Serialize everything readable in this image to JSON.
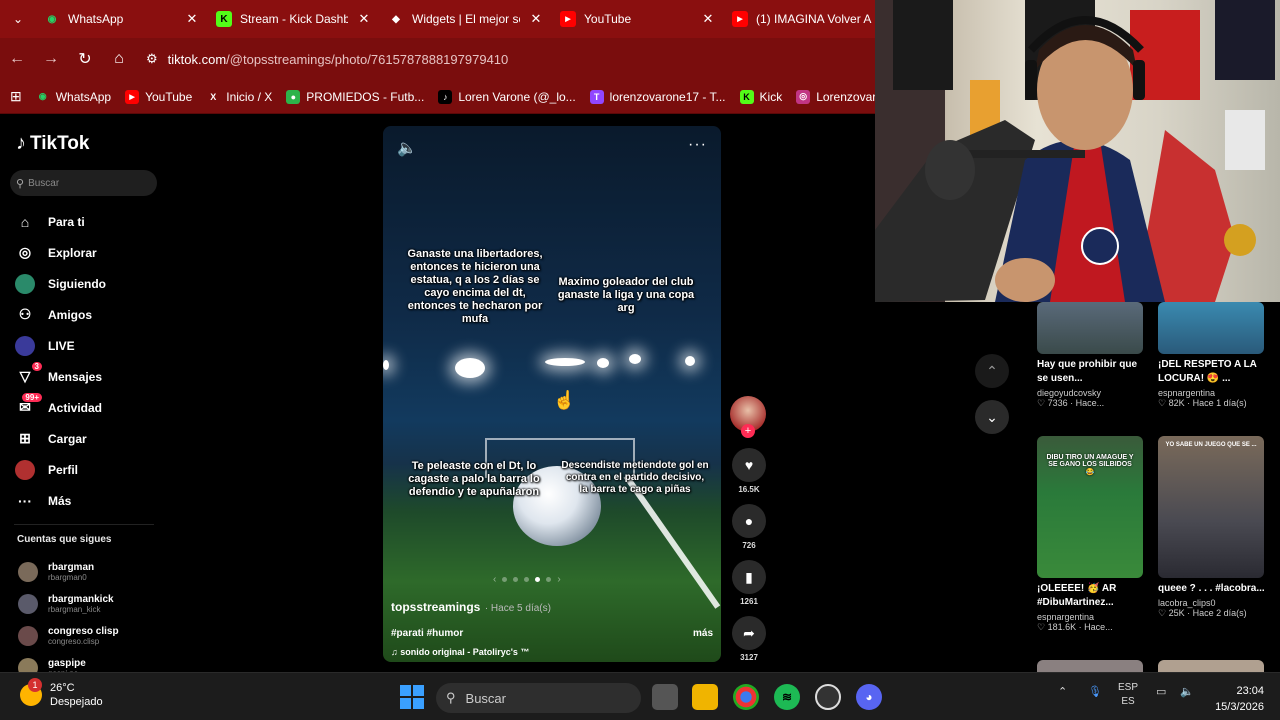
{
  "browser": {
    "tabs": [
      {
        "label": "WhatsApp",
        "color": "#25d366",
        "glyph": "W"
      },
      {
        "label": "Stream - Kick Dashbo",
        "color": "#53fc18",
        "glyph": "K"
      },
      {
        "label": "Widgets | El mejor so",
        "color": "#ffffff",
        "glyph": "◆"
      },
      {
        "label": "YouTube",
        "color": "#ff0000",
        "glyph": "▶"
      },
      {
        "label": "(1) IMAGINA Volver A",
        "color": "#ff0000",
        "glyph": "▶"
      }
    ],
    "url_domain": "tiktok.com",
    "url_path": "/@topsstreamings/photo/7615787888197979410",
    "bookmarks": [
      {
        "label": "WhatsApp",
        "color": "#25d366",
        "glyph": "W"
      },
      {
        "label": "YouTube",
        "color": "#ff0000",
        "glyph": "▶"
      },
      {
        "label": "Inicio / X",
        "color": "#000000",
        "glyph": "X"
      },
      {
        "label": "PROMIEDOS - Futb...",
        "color": "#2db34a",
        "glyph": "⚽"
      },
      {
        "label": "Loren Varone (@_lo...",
        "color": "#000000",
        "glyph": "♪"
      },
      {
        "label": "lorenzovarone17 - T...",
        "color": "#9146ff",
        "glyph": "T"
      },
      {
        "label": "Kick",
        "color": "#53fc18",
        "glyph": "K"
      },
      {
        "label": "Lorenzovaro",
        "color": "#c13584",
        "glyph": "◎"
      }
    ]
  },
  "tiktok": {
    "logo": "TikTok",
    "search_placeholder": "Buscar",
    "nav": [
      {
        "label": "Para ti",
        "icon": "home-icon",
        "glyph": "⌂"
      },
      {
        "label": "Explorar",
        "icon": "compass-icon",
        "glyph": "◎"
      },
      {
        "label": "Siguiendo",
        "icon": "following-icon",
        "glyph": "●"
      },
      {
        "label": "Amigos",
        "icon": "friends-icon",
        "glyph": "👥"
      },
      {
        "label": "LIVE",
        "icon": "live-icon",
        "glyph": "●"
      },
      {
        "label": "Mensajes",
        "icon": "messages-icon",
        "glyph": "▽",
        "badge": "3"
      },
      {
        "label": "Actividad",
        "icon": "activity-icon",
        "glyph": "●",
        "badge": "99+"
      },
      {
        "label": "Cargar",
        "icon": "upload-icon",
        "glyph": "⊞"
      },
      {
        "label": "Perfil",
        "icon": "profile-icon",
        "glyph": "●"
      },
      {
        "label": "Más",
        "icon": "more-icon",
        "glyph": "···"
      }
    ],
    "following_title": "Cuentas que sigues",
    "following": [
      {
        "name": "rbargman",
        "handle": "rbargman0"
      },
      {
        "name": "rbargmankick",
        "handle": "rbargman_kick"
      },
      {
        "name": "congreso clisp",
        "handle": "congreso.clisp"
      },
      {
        "name": "gaspipe",
        "handle": "gaspi.pe"
      }
    ],
    "video": {
      "text_1": "Ganaste una libertadores, entonces te hicieron una estatua, q a los 2 días se cayo encima del dt, entonces te hecharon por mufa",
      "text_2": "Maximo goleador del club ganaste la liga y una copa arg",
      "text_3": "Te peleaste con el Dt, lo cagaste a palo  la barra lo defendio y te apuñalaron",
      "text_4": "Descendiste metiendote gol en contra en el partido decisivo, la barra te cago a piñas",
      "author": "topsstreamings",
      "ago": "· Hace 5 día(s)",
      "tags": "#parati #humor",
      "more": "más",
      "sound": "♫  sonido original - Patoliryc's ™"
    },
    "actions": {
      "likes": "16.5K",
      "comments": "726",
      "saves": "1261",
      "shares": "3127"
    },
    "right_cards": [
      {
        "title": "Hay que prohibir que se usen...",
        "author": "diegoyudcovsky",
        "stats": "♡ 7336 · Hace..."
      },
      {
        "title": "¡DEL RESPETO A LA LOCURA! 😍 ...",
        "author": "espnargentina",
        "stats": "♡ 82K · Hace 1 día(s)"
      },
      {
        "title": "¡OLEEEE! 🥳 AR #DibuMartinez...",
        "author": "espnargentina",
        "stats": "♡ 181.6K · Hace..."
      },
      {
        "title": "queee ? . . . #lacobra...",
        "author": "lacobra_clips0",
        "stats": "♡ 25K · Hace 2 día(s)"
      }
    ],
    "thumb_caption_1": "DIBU TIRO UN AMAGUE Y SE GANO LOS SILBIDOS 😂",
    "thumb_caption_2": "YO SABE UN JUEGO QUE SE ..."
  },
  "taskbar": {
    "temp": "26°C",
    "weather": "Despejado",
    "weather_badge": "1",
    "search": "Buscar",
    "lang_1": "ESP",
    "lang_2": "ES",
    "time": "23:04",
    "date": "15/3/2026"
  },
  "colors": {
    "accent": "#fe2c55",
    "chrome": "#8a0f0f"
  }
}
